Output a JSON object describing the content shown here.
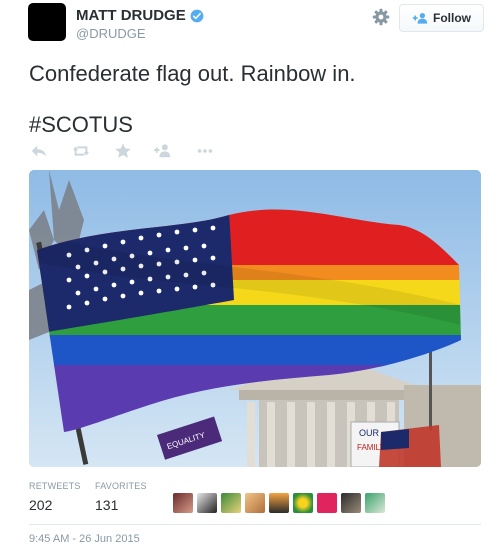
{
  "tweet": {
    "name": "MATT DRUDGE",
    "handle": "@DRUDGE",
    "follow_label": "Follow",
    "line1": "Confederate flag out. Rainbow in.",
    "line2": "#SCOTUS",
    "timestamp": "9:45 AM - 26 Jun 2015"
  },
  "icons": {
    "settings": "gear-icon",
    "follow": "add-user-icon",
    "reply": "reply-icon",
    "retweet": "retweet-icon",
    "favorite": "star-icon",
    "add_user": "add-user-icon",
    "more": "more-icon",
    "verified": "verified-badge-icon"
  },
  "photo": {
    "signs": [
      "OUR",
      "FAMILY",
      "EQUALITY"
    ]
  },
  "stats": {
    "retweets_label": "RETWEETS",
    "retweets_value": "202",
    "favorites_label": "FAVORITES",
    "favorites_value": "131"
  },
  "favoriters_count": 9,
  "colors": {
    "verified": "#55acee",
    "text": "#292f33",
    "muted": "#8899a6",
    "border": "#e1e8ed"
  }
}
